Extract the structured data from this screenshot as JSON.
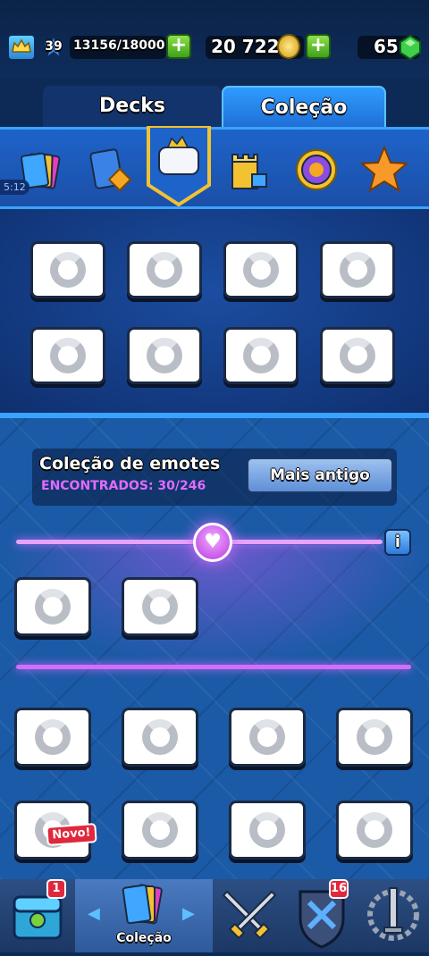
{
  "status": {
    "level": "39",
    "xp": "13156/18000",
    "gold": "20 722",
    "gems": "65"
  },
  "tabs": {
    "decks": "Decks",
    "collection": "Coleção"
  },
  "emotes": {
    "title": "Coleção de emotes",
    "found": "ENCONTRADOS: 30/246",
    "sort_label": "Mais antigo",
    "info": "i",
    "new_badge": "Novo!"
  },
  "timer_fragment": "5:12",
  "bottom_nav": {
    "shop_badge": "1",
    "collection_label": "Coleção",
    "clan_badge": "16"
  },
  "colors": {
    "accent_blue": "#3aa3ff",
    "emote_purple": "#d66cff",
    "badge_red": "#e0283d",
    "plus_green": "#4caf22"
  }
}
